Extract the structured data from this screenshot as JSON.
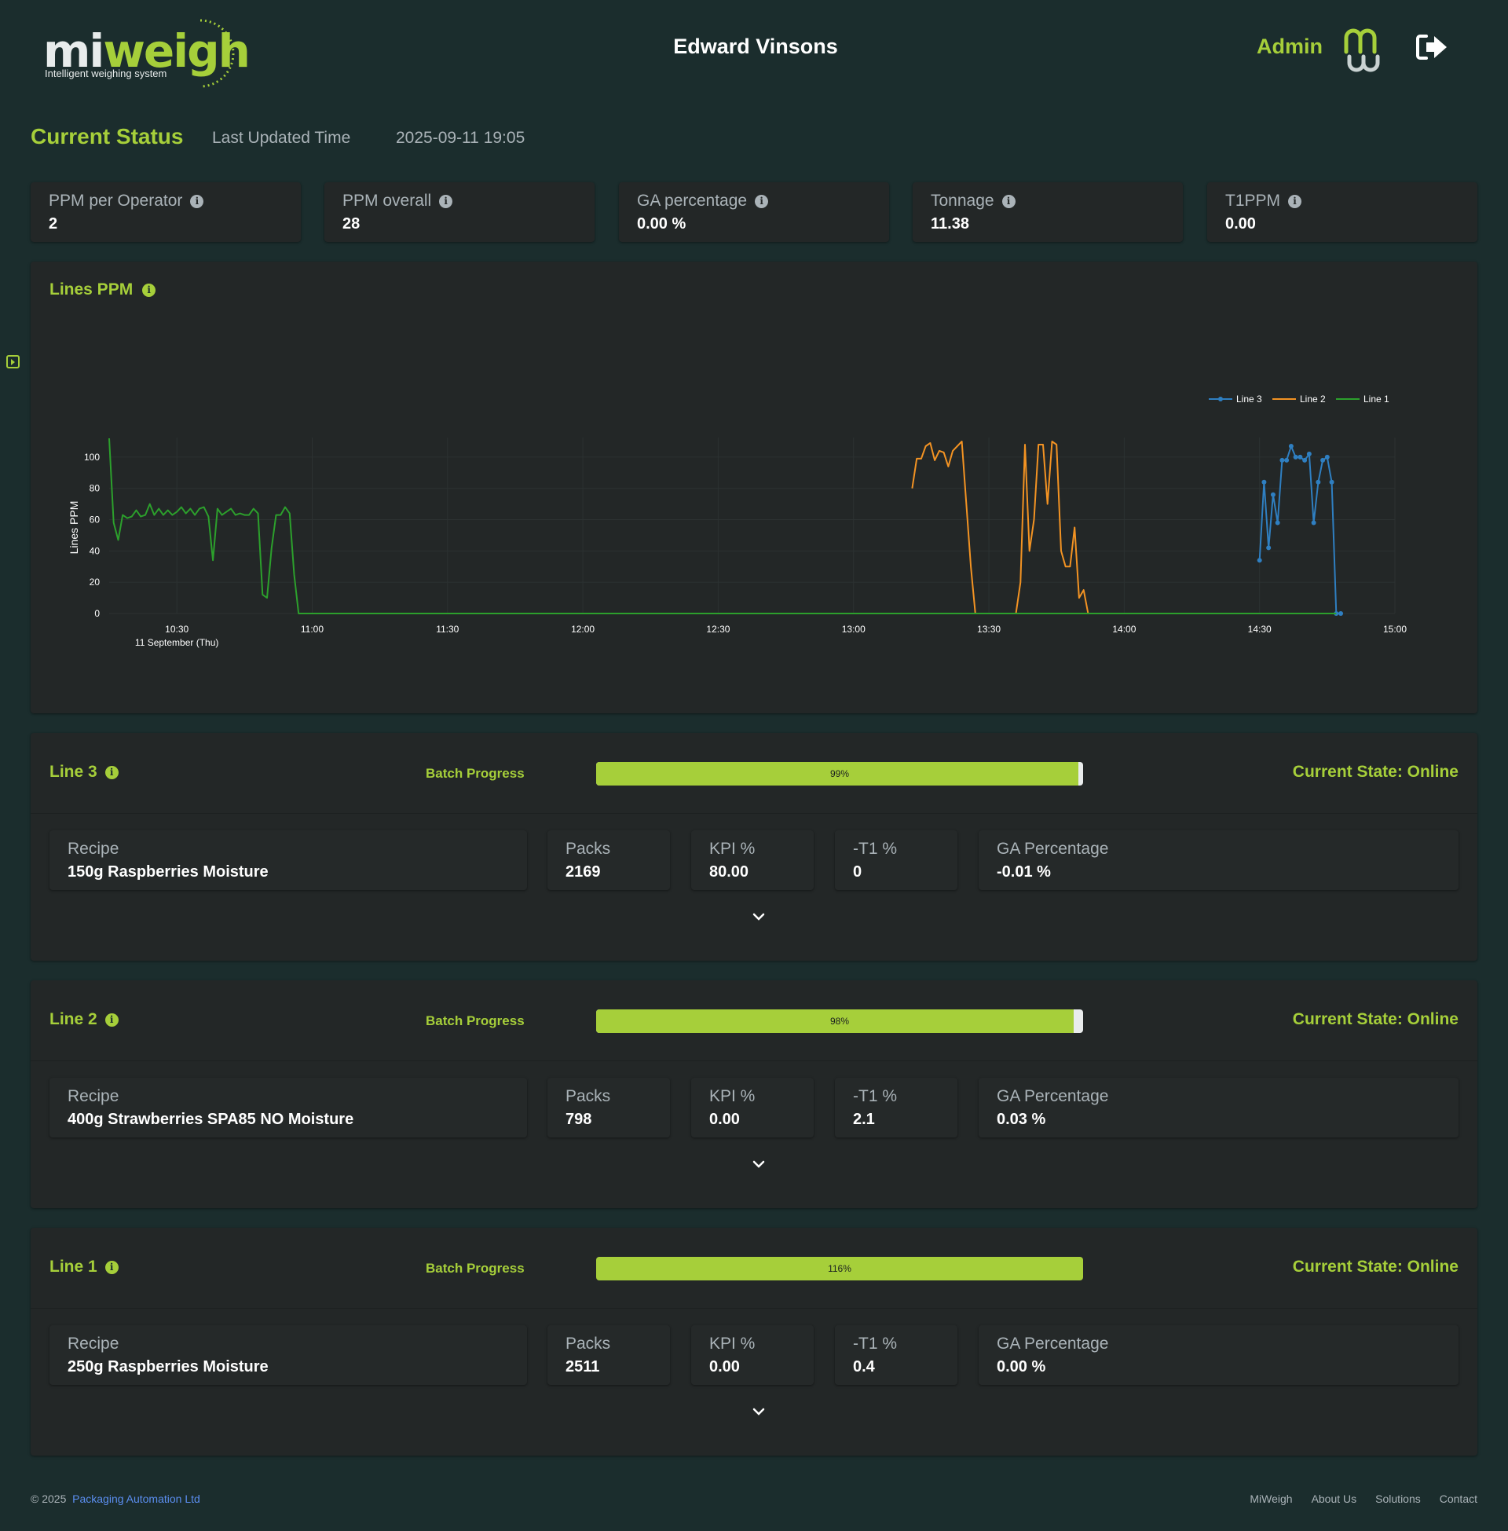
{
  "header": {
    "logo_mi": "mi",
    "logo_weigh": "weigh",
    "logo_tagline": "Intelligent weighing system",
    "title": "Edward Vinsons",
    "user_role": "Admin"
  },
  "status": {
    "title": "Current Status",
    "last_updated_label": "Last Updated Time",
    "last_updated_value": "2025-09-11 19:05"
  },
  "kpis": [
    {
      "label": "PPM per Operator",
      "value": "2"
    },
    {
      "label": "PPM overall",
      "value": "28"
    },
    {
      "label": "GA percentage",
      "value": "0.00 %"
    },
    {
      "label": "Tonnage",
      "value": "11.38"
    },
    {
      "label": "T1PPM",
      "value": "0.00"
    }
  ],
  "chart": {
    "title": "Lines PPM"
  },
  "chart_data": {
    "type": "line",
    "ylabel": "Lines PPM",
    "xlabel": "",
    "x_ticks": [
      "10:30",
      "11:00",
      "11:30",
      "12:00",
      "12:30",
      "13:00",
      "13:30",
      "14:00",
      "14:30",
      "15:00"
    ],
    "x_tick_date": "11 September (Thu)",
    "y_ticks": [
      0,
      20,
      40,
      60,
      80,
      100
    ],
    "xlim": [
      "10:15",
      "15:00"
    ],
    "ylim": [
      0,
      110
    ],
    "legend_position": "top-right",
    "grid": true,
    "series": [
      {
        "name": "Line 3",
        "color": "#2f7fc1",
        "markers": true,
        "points": [
          [
            "14:30",
            34
          ],
          [
            "14:31",
            84
          ],
          [
            "14:32",
            42
          ],
          [
            "14:33",
            76
          ],
          [
            "14:34",
            58
          ],
          [
            "14:35",
            98
          ],
          [
            "14:36",
            98
          ],
          [
            "14:37",
            107
          ],
          [
            "14:38",
            100
          ],
          [
            "14:39",
            100
          ],
          [
            "14:40",
            98
          ],
          [
            "14:41",
            102
          ],
          [
            "14:42",
            58
          ],
          [
            "14:43",
            84
          ],
          [
            "14:44",
            98
          ],
          [
            "14:45",
            100
          ],
          [
            "14:46",
            84
          ],
          [
            "14:47",
            0
          ],
          [
            "14:48",
            0
          ]
        ]
      },
      {
        "name": "Line 2",
        "color": "#f39323",
        "markers": false,
        "points": [
          [
            "13:13",
            80
          ],
          [
            "13:14",
            99
          ],
          [
            "13:15",
            99
          ],
          [
            "13:16",
            107
          ],
          [
            "13:17",
            109
          ],
          [
            "13:18",
            98
          ],
          [
            "13:19",
            104
          ],
          [
            "13:20",
            103
          ],
          [
            "13:21",
            94
          ],
          [
            "13:22",
            104
          ],
          [
            "13:23",
            107
          ],
          [
            "13:24",
            110
          ],
          [
            "13:26",
            30
          ],
          [
            "13:27",
            0
          ],
          [
            "13:36",
            0
          ],
          [
            "13:37",
            20
          ],
          [
            "13:38",
            108
          ],
          [
            "13:39",
            40
          ],
          [
            "13:40",
            60
          ],
          [
            "13:41",
            108
          ],
          [
            "13:42",
            108
          ],
          [
            "13:43",
            70
          ],
          [
            "13:44",
            110
          ],
          [
            "13:45",
            108
          ],
          [
            "13:46",
            40
          ],
          [
            "13:47",
            30
          ],
          [
            "13:48",
            30
          ],
          [
            "13:49",
            55
          ],
          [
            "13:50",
            10
          ],
          [
            "13:51",
            15
          ],
          [
            "13:52",
            0
          ],
          [
            "14:40",
            0
          ]
        ]
      },
      {
        "name": "Line 1",
        "color": "#2ca02c",
        "markers": false,
        "points": [
          [
            "10:15",
            112
          ],
          [
            "10:16",
            58
          ],
          [
            "10:17",
            47
          ],
          [
            "10:18",
            63
          ],
          [
            "10:19",
            61
          ],
          [
            "10:20",
            62
          ],
          [
            "10:21",
            66
          ],
          [
            "10:22",
            62
          ],
          [
            "10:23",
            63
          ],
          [
            "10:24",
            70
          ],
          [
            "10:25",
            63
          ],
          [
            "10:26",
            67
          ],
          [
            "10:27",
            63
          ],
          [
            "10:28",
            66
          ],
          [
            "10:29",
            63
          ],
          [
            "10:30",
            65
          ],
          [
            "10:31",
            68
          ],
          [
            "10:32",
            64
          ],
          [
            "10:33",
            67
          ],
          [
            "10:34",
            63
          ],
          [
            "10:35",
            67
          ],
          [
            "10:36",
            68
          ],
          [
            "10:37",
            62
          ],
          [
            "10:38",
            34
          ],
          [
            "10:39",
            67
          ],
          [
            "10:40",
            63
          ],
          [
            "10:41",
            65
          ],
          [
            "10:42",
            67
          ],
          [
            "10:43",
            63
          ],
          [
            "10:44",
            64
          ],
          [
            "10:45",
            63
          ],
          [
            "10:46",
            63
          ],
          [
            "10:47",
            67
          ],
          [
            "10:48",
            64
          ],
          [
            "10:49",
            12
          ],
          [
            "10:50",
            10
          ],
          [
            "10:51",
            42
          ],
          [
            "10:52",
            63
          ],
          [
            "10:53",
            63
          ],
          [
            "10:54",
            68
          ],
          [
            "10:55",
            64
          ],
          [
            "10:56",
            25
          ],
          [
            "10:57",
            0
          ],
          [
            "14:47",
            0
          ]
        ]
      }
    ]
  },
  "lines": [
    {
      "name": "Line 3",
      "batch_label": "Batch Progress",
      "progress": 99,
      "progress_text": "99%",
      "state": "Current State: Online",
      "recipe_label": "Recipe",
      "recipe": "150g Raspberries Moisture",
      "packs_label": "Packs",
      "packs": "2169",
      "kpi_label": "KPI %",
      "kpi": "80.00",
      "t1_label": "-T1 %",
      "t1": "0",
      "ga_label": "GA Percentage",
      "ga": "-0.01 %"
    },
    {
      "name": "Line 2",
      "batch_label": "Batch Progress",
      "progress": 98,
      "progress_text": "98%",
      "state": "Current State: Online",
      "recipe_label": "Recipe",
      "recipe": "400g Strawberries SPA85 NO Moisture",
      "packs_label": "Packs",
      "packs": "798",
      "kpi_label": "KPI %",
      "kpi": "0.00",
      "t1_label": "-T1 %",
      "t1": "2.1",
      "ga_label": "GA Percentage",
      "ga": "0.03 %"
    },
    {
      "name": "Line 1",
      "batch_label": "Batch Progress",
      "progress": 116,
      "progress_text": "116%",
      "state": "Current State: Online",
      "recipe_label": "Recipe",
      "recipe": "250g Raspberries Moisture",
      "packs_label": "Packs",
      "packs": "2511",
      "kpi_label": "KPI %",
      "kpi": "0.00",
      "t1_label": "-T1 %",
      "t1": "0.4",
      "ga_label": "GA Percentage",
      "ga": "0.00 %"
    }
  ],
  "footer": {
    "copyright": "© 2025",
    "company": "Packaging Automation Ltd",
    "links": [
      "MiWeigh",
      "About Us",
      "Solutions",
      "Contact"
    ]
  },
  "colors": {
    "accent": "#a6cf3a",
    "background": "#1b2d2d",
    "card": "#232727",
    "link": "#5b8ef0"
  }
}
